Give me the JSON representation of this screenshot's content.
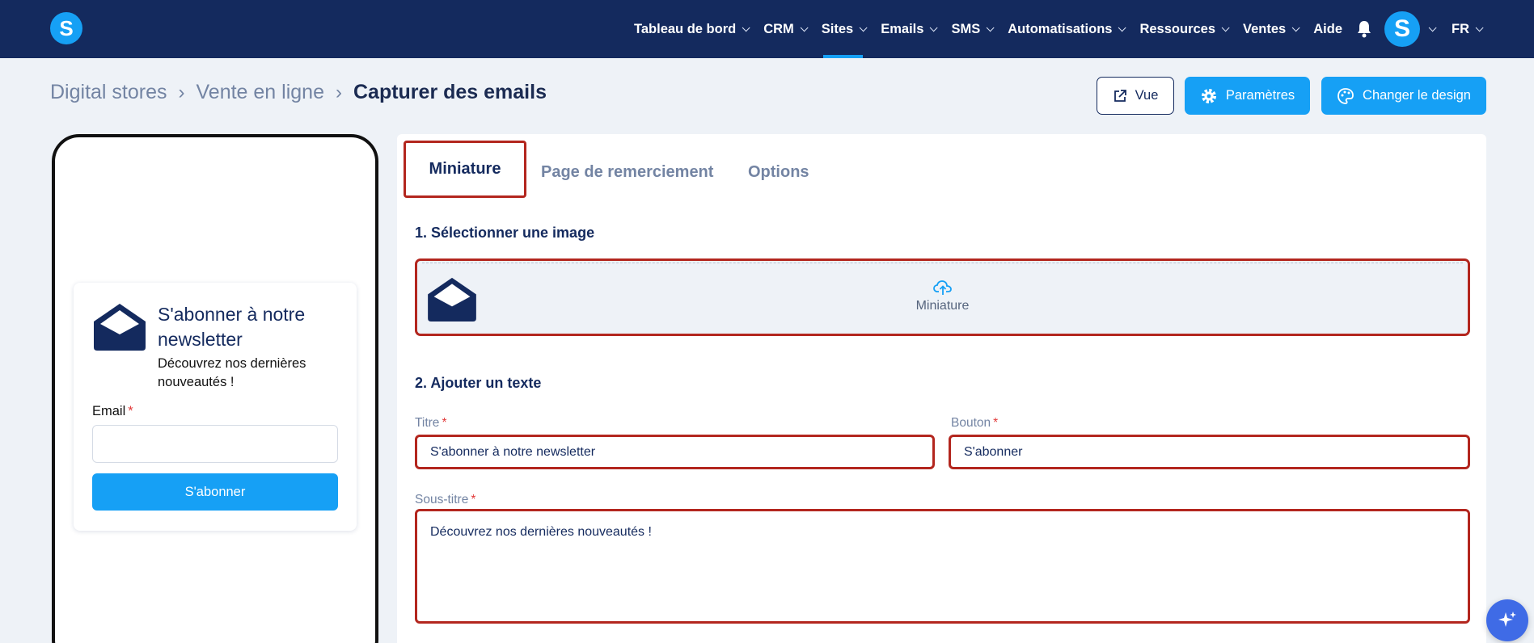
{
  "nav": {
    "logo_letter": "S",
    "items": [
      {
        "label": "Tableau de bord",
        "has_menu": true,
        "active": false
      },
      {
        "label": "CRM",
        "has_menu": true,
        "active": false
      },
      {
        "label": "Sites",
        "has_menu": true,
        "active": true
      },
      {
        "label": "Emails",
        "has_menu": true,
        "active": false
      },
      {
        "label": "SMS",
        "has_menu": true,
        "active": false
      },
      {
        "label": "Automatisations",
        "has_menu": true,
        "active": false
      },
      {
        "label": "Ressources",
        "has_menu": true,
        "active": false
      },
      {
        "label": "Ventes",
        "has_menu": true,
        "active": false
      },
      {
        "label": "Aide",
        "has_menu": false,
        "active": false
      }
    ],
    "notification_icon": "bell-icon",
    "avatar_letter": "S",
    "language": "FR"
  },
  "breadcrumb": {
    "items": [
      "Digital stores",
      "Vente en ligne"
    ],
    "current": "Capturer des emails"
  },
  "actions": {
    "view_label": "Vue",
    "settings_label": "Paramètres",
    "design_label": "Changer le design"
  },
  "preview": {
    "title": "S'abonner à notre newsletter",
    "subtitle": "Découvrez nos dernières nouveautés !",
    "email_label": "Email",
    "required_mark": "*",
    "submit_label": "S'abonner"
  },
  "tabs": {
    "miniature": "Miniature",
    "thanks_page": "Page de remerciement",
    "options": "Options"
  },
  "form": {
    "section_image": "1. Sélectionner une image",
    "upload_label": "Miniature",
    "section_text": "2. Ajouter un texte",
    "title_label": "Titre",
    "title_value": "S'abonner à notre newsletter",
    "button_label": "Bouton",
    "button_value": "S'abonner",
    "subtitle_label": "Sous-titre",
    "subtitle_value": "Découvrez nos dernières nouveautés !",
    "required_mark": "*"
  },
  "colors": {
    "navbar": "#142a5e",
    "accent": "#16a0f5",
    "highlight_border": "#b3261e",
    "page_bg": "#eef2f7",
    "assistant_fab": "#3f6be6"
  }
}
